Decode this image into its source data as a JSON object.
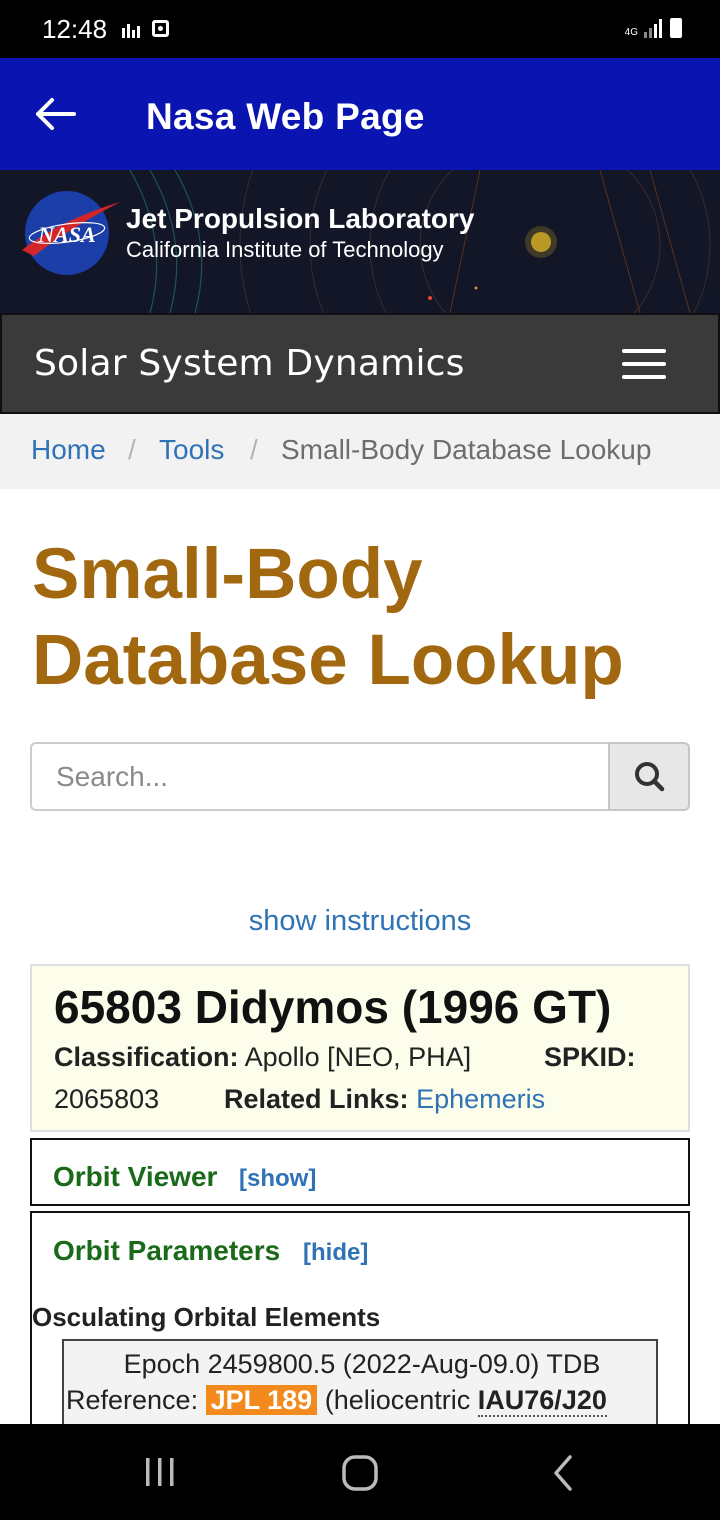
{
  "status": {
    "time": "12:48",
    "network": "4G"
  },
  "app_bar": {
    "title": "Nasa Web Page"
  },
  "banner": {
    "logo_text": "NASA",
    "title": "Jet Propulsion Laboratory",
    "subtitle": "California Institute of Technology"
  },
  "ssd": {
    "title": "Solar System Dynamics"
  },
  "breadcrumb": {
    "home": "Home",
    "tools": "Tools",
    "sep": "/",
    "current": "Small-Body Database Lookup"
  },
  "page": {
    "title_line1": "Small-Body",
    "title_line2": "Database Lookup"
  },
  "search": {
    "placeholder": "Search..."
  },
  "instructions_link": "show instructions",
  "object": {
    "name": "65803 Didymos (1996 GT)",
    "classification_label": "Classification:",
    "classification_value": "Apollo [NEO, PHA]",
    "spkid_label": "SPKID:",
    "spkid_value": "2065803",
    "related_label": "Related Links:",
    "related_link": "Ephemeris"
  },
  "orbit_viewer": {
    "title": "Orbit Viewer",
    "toggle": "[show]"
  },
  "orbit_params": {
    "title": "Orbit Parameters",
    "toggle": "[hide]",
    "osc_title": "Osculating Orbital Elements",
    "epoch": "Epoch 2459800.5 (2022-Aug-09.0) TDB",
    "ref_label": "Reference:",
    "ref_tag": "JPL 189",
    "ref_rest": "(heliocentric",
    "ref_frame": "IAU76/J20"
  },
  "colors": {
    "app_bar": "#0a14b0",
    "title_gold": "#a2680f",
    "link_blue": "#2f73b6",
    "panel_green": "#1a6a1a",
    "jpl_tag": "#f28a1d"
  }
}
